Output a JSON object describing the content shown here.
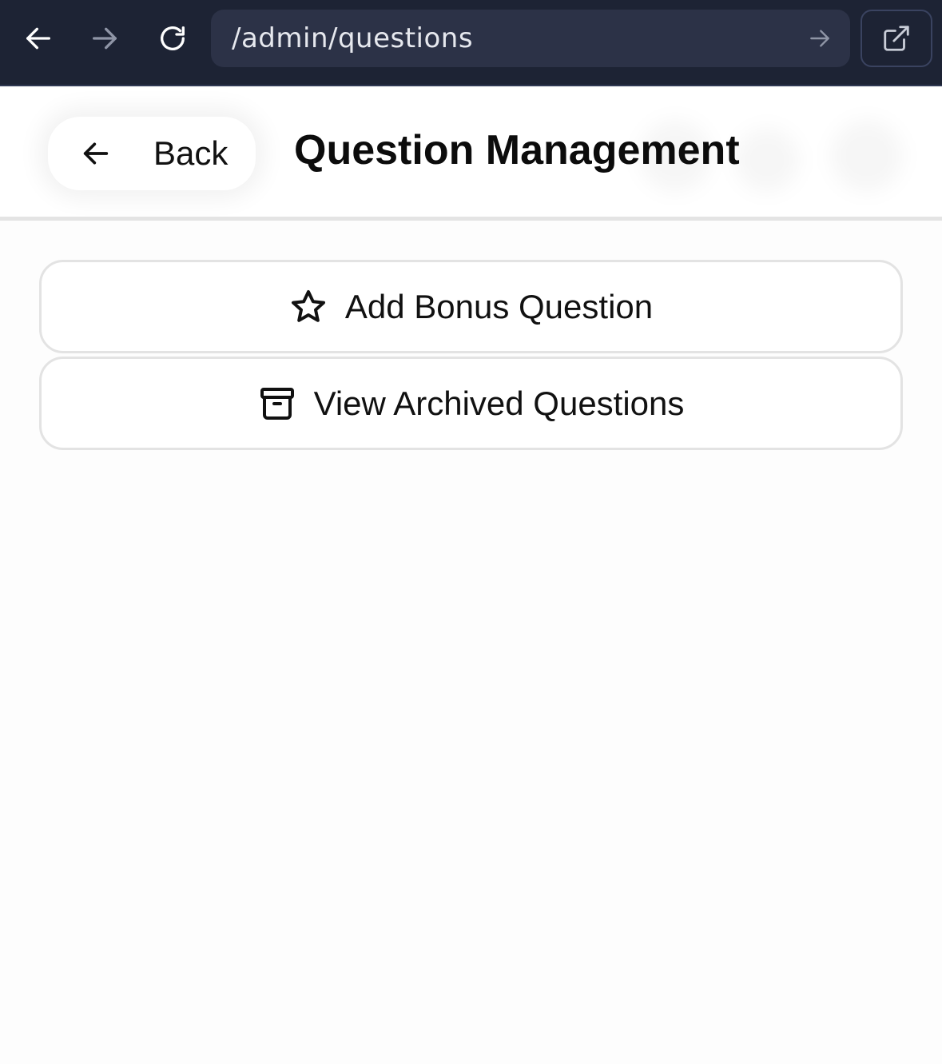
{
  "browser": {
    "url": "/admin/questions",
    "icons": {
      "back": "arrow-left-icon",
      "forward": "arrow-right-icon",
      "reload": "reload-icon",
      "go": "arrow-right-icon",
      "open_external": "external-link-icon"
    }
  },
  "header": {
    "back_label": "Back",
    "title": "Question Management"
  },
  "actions": [
    {
      "label": "Add Bonus Question",
      "icon": "star-icon"
    },
    {
      "label": "View Archived Questions",
      "icon": "archive-icon"
    }
  ],
  "colors": {
    "chrome_bg": "#1d2334",
    "urlbar_bg": "#2c3247",
    "page_bg": "#fdfdfd",
    "button_border": "#e3e3e3",
    "text": "#111111"
  }
}
